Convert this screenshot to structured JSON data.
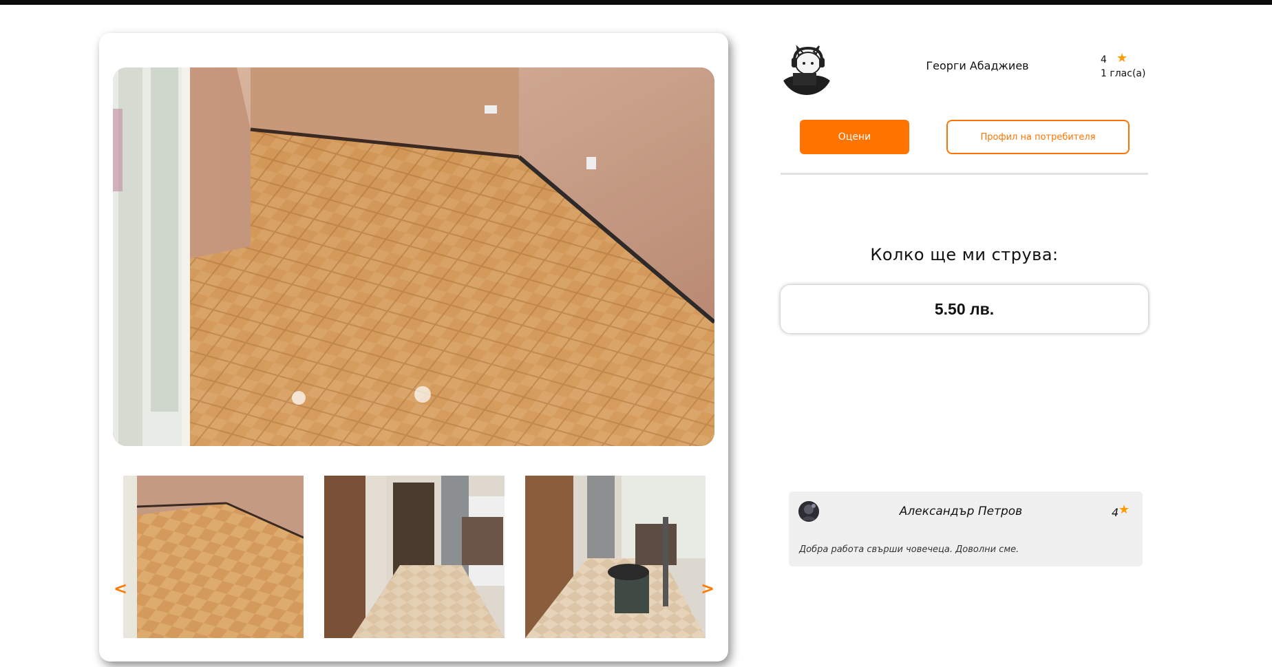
{
  "user": {
    "name": "Георги Абаджиев",
    "rating": "4",
    "votes": "1 глас(а)"
  },
  "actions": {
    "rate_label": "Оцени",
    "profile_label": "Профил на потребителя"
  },
  "price": {
    "title": "Колко ще ми струва:",
    "value": "5.50 лв."
  },
  "gallery": {
    "prev_arrow": "<",
    "next_arrow": ">"
  },
  "review": {
    "author": "Александър Петров",
    "score": "4",
    "text": "Добра работа свърши човечеца. Доволни сме."
  },
  "colors": {
    "accent": "#ff7400",
    "star": "#ff9a00",
    "review_bg": "#f0f0f0"
  },
  "icons": {
    "rating_star": "star-icon",
    "arrows": "chevron-icons"
  }
}
